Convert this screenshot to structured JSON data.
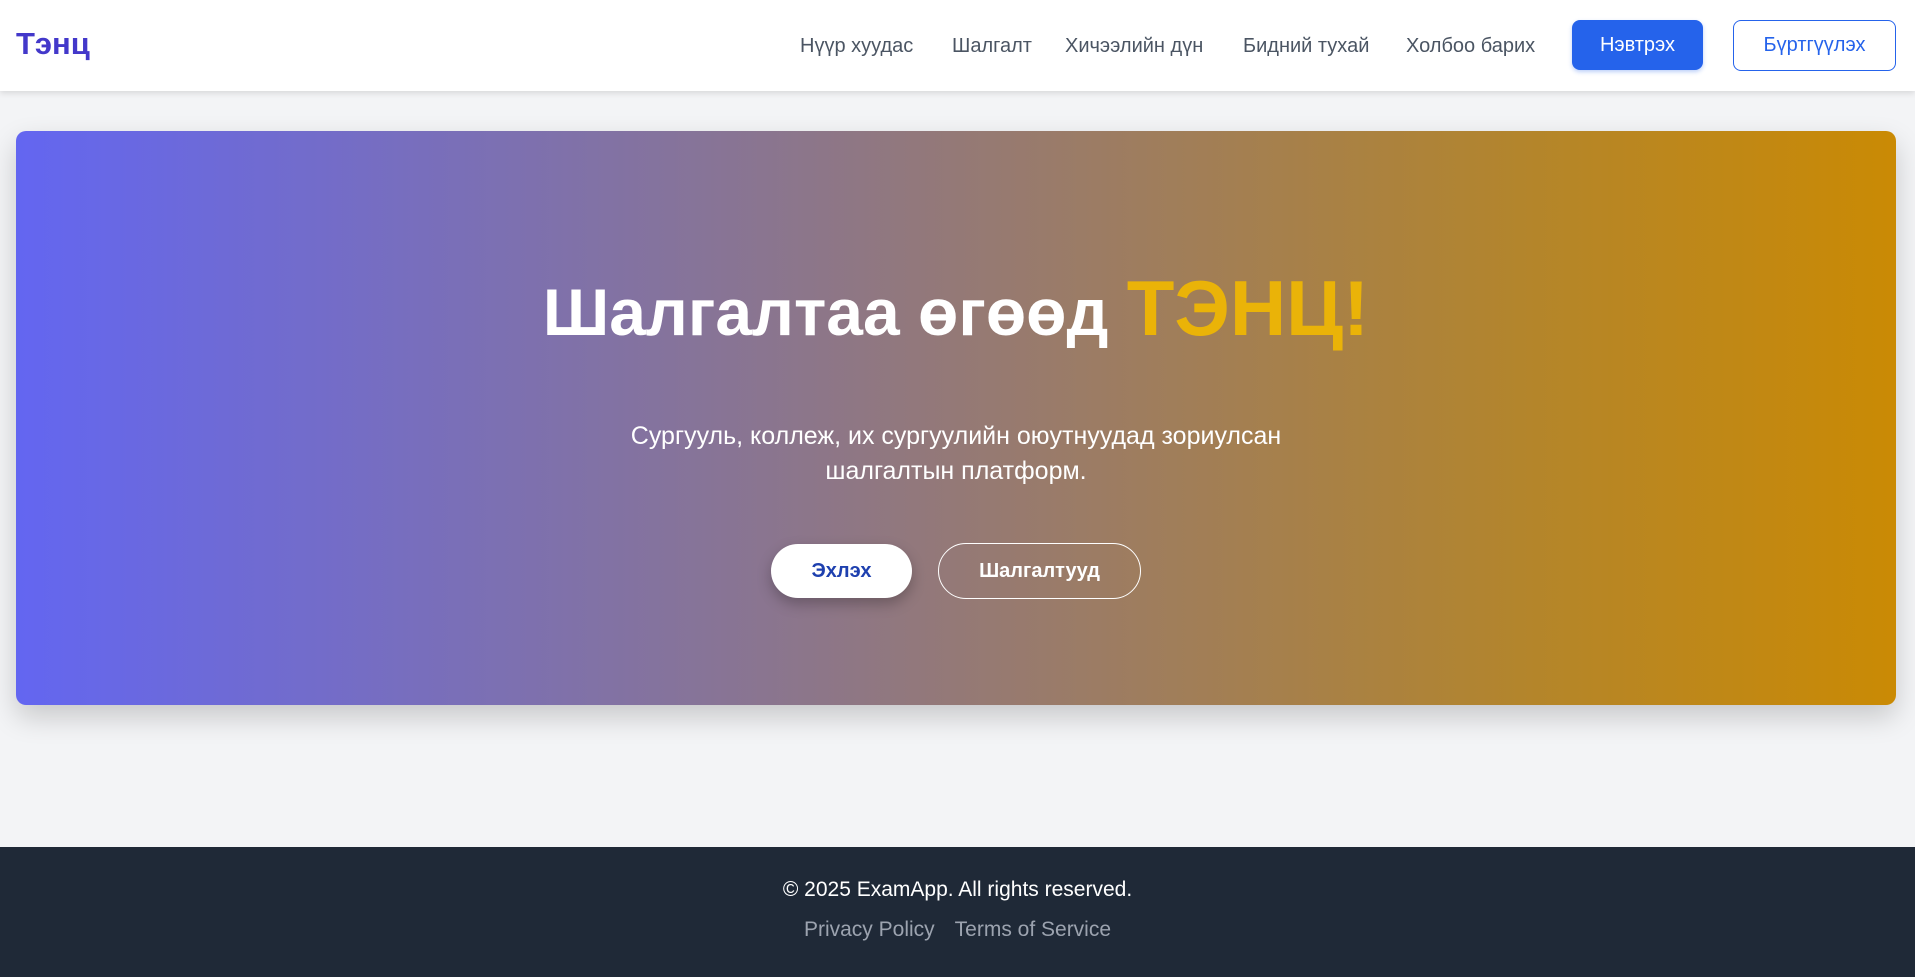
{
  "header": {
    "logo": "Тэнц",
    "nav": [
      {
        "label": "Нүүр хуудас"
      },
      {
        "label": "Шалгалт"
      },
      {
        "label": "Хичээлийн дүн"
      },
      {
        "label": "Бидний тухай"
      },
      {
        "label": "Холбоо барих"
      }
    ],
    "login_label": "Нэвтрэх",
    "register_label": "Бүртгүүлэх"
  },
  "hero": {
    "title_main": "Шалгалтаа өгөөд",
    "title_accent": "ТЭНЦ!",
    "subtitle": "Сургууль, коллеж, их сургуулийн оюутнуудад зориулсан шалгалтын платформ.",
    "start_label": "Эхлэх",
    "exams_label": "Шалгалтууд"
  },
  "footer": {
    "copyright": "© 2025 ExamApp. All rights reserved.",
    "links": [
      {
        "label": "Privacy Policy"
      },
      {
        "label": "Terms of Service"
      }
    ]
  },
  "colors": {
    "brand": "#4338ca",
    "primary": "#2563eb",
    "accent": "#eab308",
    "gradient_start": "#6366f1",
    "gradient_end": "#ca8a04",
    "footer_bg": "#1f2937"
  }
}
